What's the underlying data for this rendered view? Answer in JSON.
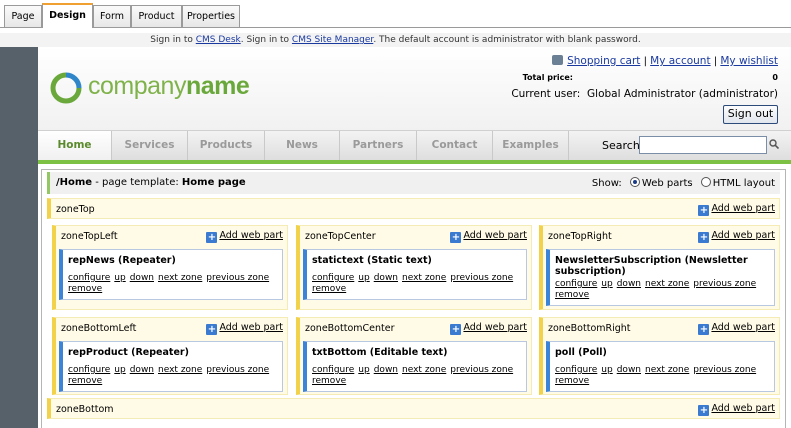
{
  "tabs": [
    "Page",
    "Design",
    "Form",
    "Product",
    "Properties"
  ],
  "notice": {
    "part1": "Sign in to ",
    "link1": "CMS Desk",
    "part2": ". Sign in to ",
    "link2": "CMS Site Manager",
    "part3": ". The default account is administrator with blank password."
  },
  "header": {
    "logo_text_light": "company",
    "logo_text_bold": "name",
    "links": {
      "cart": "Shopping cart",
      "sep": " | ",
      "account": "My account",
      "wishlist": "My wishlist"
    },
    "total_label": "Total price:",
    "total_value": "0",
    "current_user_label": "Current user:",
    "current_user": "Global Administrator (administrator)",
    "signout": "Sign out"
  },
  "menu": {
    "items": [
      "Home",
      "Services",
      "Products",
      "News",
      "Partners",
      "Contact",
      "Examples"
    ],
    "search_label": "Search:",
    "search_value": ""
  },
  "design": {
    "path": "/Home",
    "template_text": " - page template: ",
    "template_name": "Home page",
    "show_label": "Show:",
    "opt_webparts": "Web parts",
    "opt_html": "HTML layout",
    "add_label": "Add web part",
    "zones": {
      "top": "zoneTop",
      "top_left": "zoneTopLeft",
      "top_center": "zoneTopCenter",
      "top_right": "zoneTopRight",
      "bottom_left": "zoneBottomLeft",
      "bottom_center": "zoneBottomCenter",
      "bottom_right": "zoneBottomRight",
      "bottom": "zoneBottom"
    },
    "webparts": {
      "top_left": "repNews (Repeater)",
      "top_center": "statictext (Static text)",
      "top_right": "NewsletterSubscription (Newsletter subscription)",
      "bottom_left": "repProduct (Repeater)",
      "bottom_center": "txtBottom (Editable text)",
      "bottom_right": "poll (Poll)"
    },
    "actions": [
      "configure",
      "up",
      "down",
      "next zone",
      "previous zone",
      "remove"
    ]
  },
  "colors": {
    "accent_green": "#7cc144",
    "zone_yellow": "#f1d24a",
    "webpart_blue": "#3b84d8",
    "link_blue": "#1a3aa0"
  }
}
